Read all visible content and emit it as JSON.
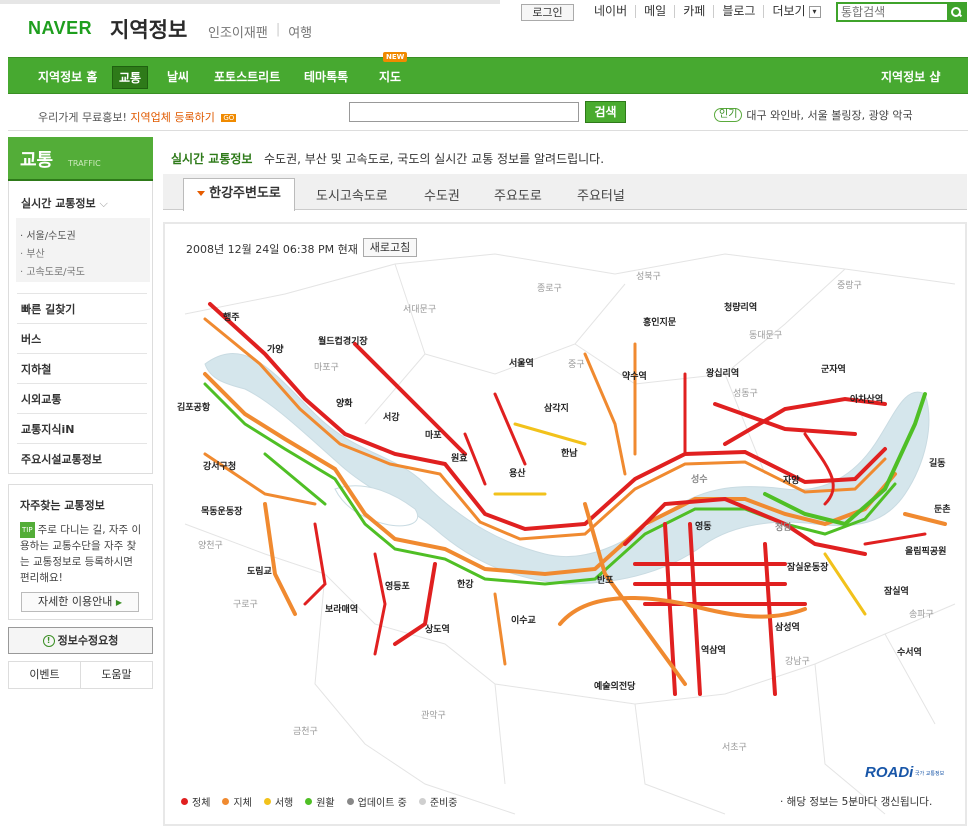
{
  "header": {
    "logo_naver": "NAVER",
    "logo_title": "지역정보",
    "sub_links": [
      "인조이재팬",
      "여행"
    ],
    "login": "로그인",
    "services": [
      "네이버",
      "메일",
      "카페",
      "블로그",
      "더보기"
    ],
    "search_placeholder": "통합검색"
  },
  "nav": {
    "items": [
      "지역정보 홈",
      "교통",
      "날씨",
      "포토스트리트",
      "테마톡톡",
      "지도"
    ],
    "new_badge": "NEW",
    "shop": "지역정보 샵"
  },
  "promo": {
    "prefix": "우리가게 무료홍보!",
    "link": "지역업체 등록하기",
    "go": "GO",
    "search_btn": "검색",
    "popular_tag": "인기",
    "popular_text": "대구 와인바, 서울 볼링장, 광양 악국"
  },
  "sidebar": {
    "title": "교통",
    "title_en": "TRAFFIC",
    "realtime": "실시간 교통정보",
    "sub_items": [
      "· 서울/수도권",
      "· 부산",
      "· 고속도로/국도"
    ],
    "items": [
      "빠른 길찾기",
      "버스",
      "지하철",
      "시외교통",
      "교통지식iN",
      "주요시설교통정보"
    ],
    "fav_title": "자주찾는 교통정보",
    "tip": "TIP",
    "fav_text": "주로 다니는 길, 자주 이용하는 교통수단을 자주 찾는 교통정보로 등록하시면 편리해요!",
    "fav_btn": "자세한 이용안내",
    "request": "정보수정요청",
    "event": "이벤트",
    "help": "도움말"
  },
  "main": {
    "label": "실시간 교통정보",
    "desc": "수도권, 부산 및 고속도로, 국도의 실시간 교통 정보를 알려드립니다.",
    "tabs": [
      "한강주변도로",
      "도시고속도로",
      "수도권",
      "주요도로",
      "주요터널"
    ],
    "timestamp": "2008년 12월 24일 06:38 PM 현재",
    "refresh": "새로고침",
    "legend": [
      "정체",
      "지체",
      "서행",
      "원활",
      "업데이트 중",
      "준비중"
    ],
    "legend_colors": [
      "#e02020",
      "#f08a30",
      "#f2c21b",
      "#4fbf25",
      "#888888",
      "#cfcfcf"
    ],
    "note": "· 해당 정보는 5분마다 갱신됩니다.",
    "roadi": "ROADi",
    "roadi_sub": "국가 교통정보"
  },
  "map_labels": {
    "bold": [
      "행주",
      "가양",
      "월드컵경기장",
      "김포공항",
      "양화",
      "서강",
      "마포",
      "원효",
      "서울역",
      "삼각지",
      "용산",
      "한남",
      "약수역",
      "왕십리역",
      "홍인지문",
      "청량리역",
      "군자역",
      "아차산역",
      "자양",
      "성수",
      "영동",
      "청담",
      "잠실운동장",
      "올림픽공원",
      "둔촌",
      "길동",
      "잠실역",
      "삼성역",
      "수서역",
      "역삼역",
      "예술의전당",
      "이수교",
      "반포",
      "한강",
      "영등포",
      "상도역",
      "보라매역",
      "도림교",
      "목동운동장",
      "강서구청"
    ],
    "gray": [
      "종로구",
      "성북구",
      "중랑구",
      "서대문구",
      "동대문구",
      "마포구",
      "중구",
      "성동구",
      "양천구",
      "구로구",
      "금천구",
      "관악구",
      "서초구",
      "강남구",
      "송파구"
    ]
  }
}
